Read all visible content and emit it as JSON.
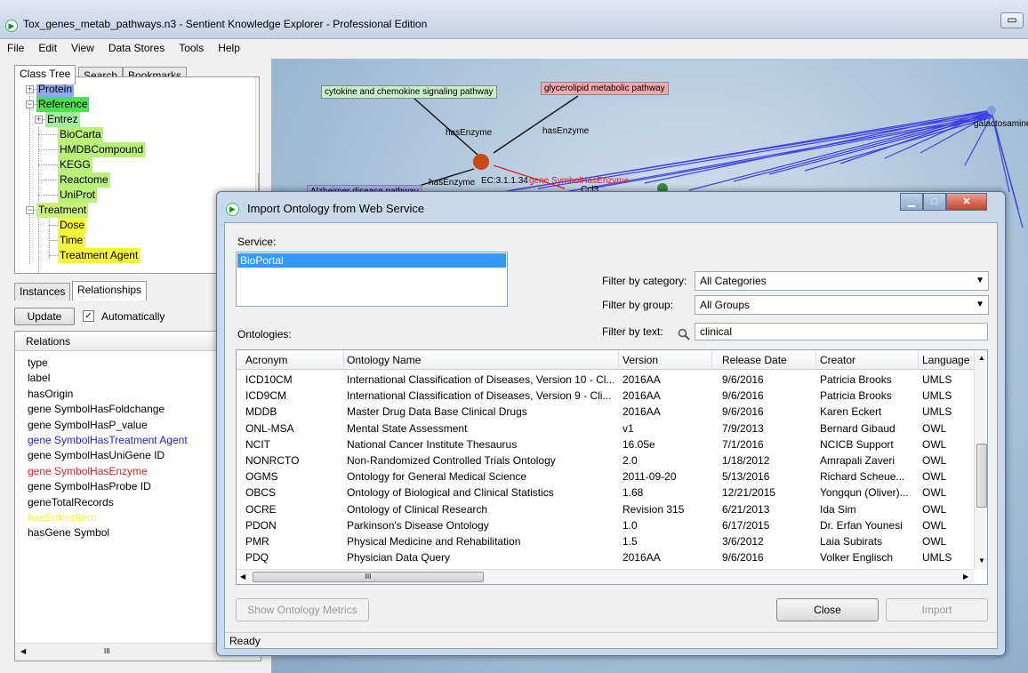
{
  "app": {
    "title": "Tox_genes_metab_pathways.n3 - Sentient Knowledge Explorer - Professional Edition",
    "minimize": "▭"
  },
  "menu": [
    "File",
    "Edit",
    "View",
    "Data Stores",
    "Tools",
    "Help"
  ],
  "left_tabs": [
    "Class Tree",
    "Search",
    "Bookmarks"
  ],
  "tree": [
    {
      "label": "Protein",
      "color": "#8fa8f0"
    },
    {
      "label": "Reference",
      "color": "#4fe04f"
    },
    {
      "label": "Entrez",
      "color": "#9ef09e"
    },
    {
      "label": "BioCarta",
      "color": "#b8f07a"
    },
    {
      "label": "HMDBCompound",
      "color": "#b8f07a"
    },
    {
      "label": "KEGG",
      "color": "#b8f07a"
    },
    {
      "label": "Reactome",
      "color": "#b8f07a"
    },
    {
      "label": "UniProt",
      "color": "#b8f07a"
    },
    {
      "label": "Treatment",
      "color": "#c8f07a"
    },
    {
      "label": "Dose",
      "color": "#f5f53a"
    },
    {
      "label": "Time",
      "color": "#f5f53a"
    },
    {
      "label": "Treatment Agent",
      "color": "#f5f53a"
    }
  ],
  "rel_tabs": [
    "Instances",
    "Relationships"
  ],
  "update_label": "Update",
  "auto_label": "Automatically",
  "relations_header": "Relations",
  "relations": [
    {
      "label": "type",
      "color": "#000000"
    },
    {
      "label": "label",
      "color": "#000000"
    },
    {
      "label": "hasOrigin",
      "color": "#000000"
    },
    {
      "label": "gene SymbolHasFoldchange",
      "color": "#000000"
    },
    {
      "label": "gene SymbolHasP_value",
      "color": "#000000"
    },
    {
      "label": "gene SymbolHasTreatment Agent",
      "color": "#1f1fd6"
    },
    {
      "label": "gene SymbolHasUniGene ID",
      "color": "#000000"
    },
    {
      "label": "gene SymbolHasEnzyme",
      "color": "#e02020"
    },
    {
      "label": "gene SymbolHasProbe ID",
      "color": "#000000"
    },
    {
      "label": "geneTotalRecords",
      "color": "#000000"
    },
    {
      "label": "hasEntrezItem",
      "color": "#f5f53a"
    },
    {
      "label": "hasGene Symbol",
      "color": "#000000"
    }
  ],
  "graph": {
    "node1": "cytokine and chemokine signaling pathway",
    "node2": "glycerolipid metabolic pathway",
    "node3": "Alzheimer disease pathway",
    "edge1": "hasEnzyme",
    "edge2": "hasEnzyme",
    "edge3": "hasEnzyme",
    "ec": "EC:3.1.1.34",
    "gene_edge": "gene SymbolHasEnzyme",
    "node_r": "galactosamine",
    "cc": "Ccl3"
  },
  "dialog": {
    "title": "Import Ontology from Web Service",
    "service_label": "Service:",
    "service_selected": "BioPortal",
    "filter_category_label": "Filter by category:",
    "filter_category_value": "All Categories",
    "filter_group_label": "Filter by group:",
    "filter_group_value": "All Groups",
    "filter_text_label": "Filter by text:",
    "filter_text_value": "clinical",
    "ontologies_label": "Ontologies:",
    "columns": [
      "Acronym",
      "Ontology Name",
      "Version",
      "Release Date",
      "Creator",
      "Language"
    ],
    "rows": [
      [
        "ICD10CM",
        "International Classification of Diseases, Version 10 - Cl...",
        "2016AA",
        "9/6/2016",
        "Patricia Brooks",
        "UMLS"
      ],
      [
        "ICD9CM",
        "International Classification of Diseases, Version 9 - Cli...",
        "2016AA",
        "9/6/2016",
        "Patricia Brooks",
        "UMLS"
      ],
      [
        "MDDB",
        "Master Drug Data Base Clinical Drugs",
        "2016AA",
        "9/6/2016",
        "Karen Eckert",
        "UMLS"
      ],
      [
        "ONL-MSA",
        "Mental State Assessment",
        "v1",
        "7/9/2013",
        "Bernard Gibaud",
        "OWL"
      ],
      [
        "NCIT",
        "National Cancer Institute Thesaurus",
        "16.05e",
        "7/1/2016",
        "NCICB Support",
        "OWL"
      ],
      [
        "NONRCTO",
        "Non-Randomized Controlled Trials Ontology",
        "2.0",
        "1/18/2012",
        "Amrapali Zaveri",
        "OWL"
      ],
      [
        "OGMS",
        "Ontology for General Medical Science",
        "2011-09-20",
        "5/13/2016",
        "Richard Scheue...",
        "OWL"
      ],
      [
        "OBCS",
        "Ontology of Biological and Clinical Statistics",
        "1.68",
        "12/21/2015",
        "Yongqun (Oliver)...",
        "OWL"
      ],
      [
        "OCRE",
        "Ontology of Clinical Research",
        "Revision 315",
        "6/21/2013",
        "Ida Sim",
        "OWL"
      ],
      [
        "PDON",
        "Parkinson's Disease Ontology",
        "1.0",
        "6/17/2015",
        "Dr. Erfan Younesi",
        "OWL"
      ],
      [
        "PMR",
        "Physical Medicine and Rehabilitation",
        "1.5",
        "3/6/2012",
        "Laia Subirats",
        "OWL"
      ],
      [
        "PDQ",
        "Physician Data Query",
        "2016AA",
        "9/6/2016",
        "Volker Englisch",
        "UMLS"
      ]
    ],
    "show_metrics": "Show Ontology Metrics",
    "close": "Close",
    "import": "Import",
    "status": "Ready",
    "hscroll_grip": "III"
  }
}
